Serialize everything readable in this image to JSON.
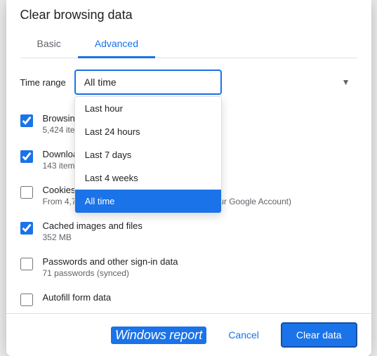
{
  "dialog": {
    "title": "Clear browsing data",
    "tabs": [
      {
        "id": "basic",
        "label": "Basic",
        "active": false
      },
      {
        "id": "advanced",
        "label": "Advanced",
        "active": true
      }
    ],
    "time_range": {
      "label": "Time range",
      "selected": "All time",
      "options": [
        {
          "label": "Last hour",
          "value": "last_hour",
          "selected": false
        },
        {
          "label": "Last 24 hours",
          "value": "last_24",
          "selected": false
        },
        {
          "label": "Last 7 days",
          "value": "last_7",
          "selected": false
        },
        {
          "label": "Last 4 weeks",
          "value": "last_4w",
          "selected": false
        },
        {
          "label": "All time",
          "value": "all_time",
          "selected": true
        }
      ]
    },
    "checkboxes": [
      {
        "id": "browsing",
        "checked": true,
        "title": "Browsing history",
        "desc": "5,424 items"
      },
      {
        "id": "downloads",
        "checked": true,
        "title": "Download history",
        "desc": "143 items"
      },
      {
        "id": "cookies",
        "checked": false,
        "title": "Cookies and other site data",
        "desc": "From 4,780 sites (you won't be signed out of your Google Account)"
      },
      {
        "id": "cached",
        "checked": true,
        "title": "Cached images and files",
        "desc": "352 MB"
      },
      {
        "id": "passwords",
        "checked": false,
        "title": "Passwords and other sign-in data",
        "desc": "71 passwords (synced)"
      },
      {
        "id": "autofill",
        "checked": false,
        "title": "Autofill form data",
        "desc": ""
      }
    ],
    "footer": {
      "cancel_label": "Cancel",
      "clear_label": "Clear data",
      "brand_windows": "Windows",
      "brand_report": "report"
    }
  }
}
